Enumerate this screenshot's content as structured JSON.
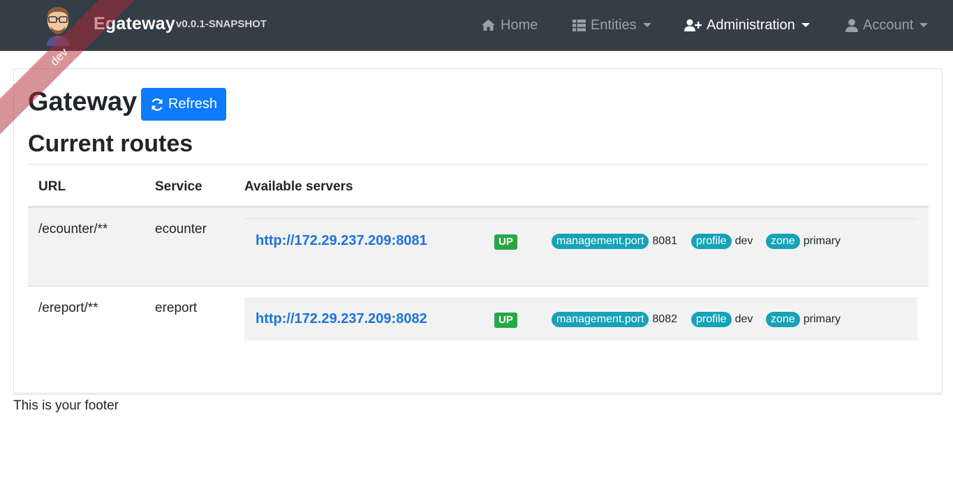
{
  "navbar": {
    "brand_title": "Egateway",
    "brand_version": "v0.0.1-SNAPSHOT",
    "items": [
      {
        "label": "Home",
        "icon": "home-icon"
      },
      {
        "label": "Entities",
        "icon": "table-list-icon"
      },
      {
        "label": "Administration",
        "icon": "user-plus-icon"
      },
      {
        "label": "Account",
        "icon": "user-icon"
      }
    ]
  },
  "ribbon": {
    "label": "dev"
  },
  "page": {
    "title": "Gateway",
    "refresh_label": "Refresh",
    "section_title": "Current routes"
  },
  "table": {
    "headers": [
      "URL",
      "Service",
      "Available servers"
    ],
    "rows": [
      {
        "url": "/ecounter/**",
        "service": "ecounter",
        "server": {
          "link": "http://172.29.237.209:8081",
          "status": "UP",
          "meta": [
            {
              "key": "management.port",
              "value": "8081"
            },
            {
              "key": "profile",
              "value": "dev"
            },
            {
              "key": "zone",
              "value": "primary"
            }
          ]
        }
      },
      {
        "url": "/ereport/**",
        "service": "ereport",
        "server": {
          "link": "http://172.29.237.209:8082",
          "status": "UP",
          "meta": [
            {
              "key": "management.port",
              "value": "8082"
            },
            {
              "key": "profile",
              "value": "dev"
            },
            {
              "key": "zone",
              "value": "primary"
            }
          ]
        }
      }
    ]
  },
  "footer": {
    "text": "This is your footer"
  },
  "colors": {
    "navbar_bg": "#353d47",
    "primary": "#0d7bfb",
    "success": "#28a745",
    "info": "#17a2b8",
    "link": "#1a73d9"
  }
}
